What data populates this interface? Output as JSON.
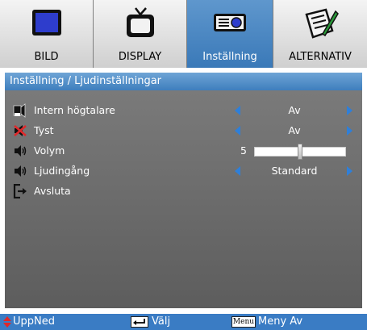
{
  "tabs": [
    {
      "label": "BILD",
      "icon": "monitor-icon",
      "active": false
    },
    {
      "label": "DISPLAY",
      "icon": "tv-icon",
      "active": false
    },
    {
      "label": "Inställning",
      "icon": "projector-icon",
      "active": true
    },
    {
      "label": "ALTERNATIV",
      "icon": "notepad-pencil-icon",
      "active": false
    }
  ],
  "header": {
    "title": "Inställning / Ljudinställningar"
  },
  "rows": [
    {
      "label": "Intern högtalare",
      "icon": "internal-speaker-icon",
      "value": "Av"
    },
    {
      "label": "Tyst",
      "icon": "mute-icon",
      "value": "Av"
    },
    {
      "label": "Volym",
      "icon": "volume-icon",
      "value": "5",
      "level": 0.5
    },
    {
      "label": "Ljudingång",
      "icon": "audio-input-icon",
      "value": "Standard"
    },
    {
      "label": "Avsluta",
      "icon": "exit-icon"
    }
  ],
  "footer": {
    "updown": "UppNed",
    "select": "Välj",
    "menu_key": "Menu",
    "menu_off": "Meny Av"
  },
  "colors": {
    "accent": "#3a7cc4",
    "arrow": "#2f7fd8",
    "body": "#6b6b6b"
  }
}
